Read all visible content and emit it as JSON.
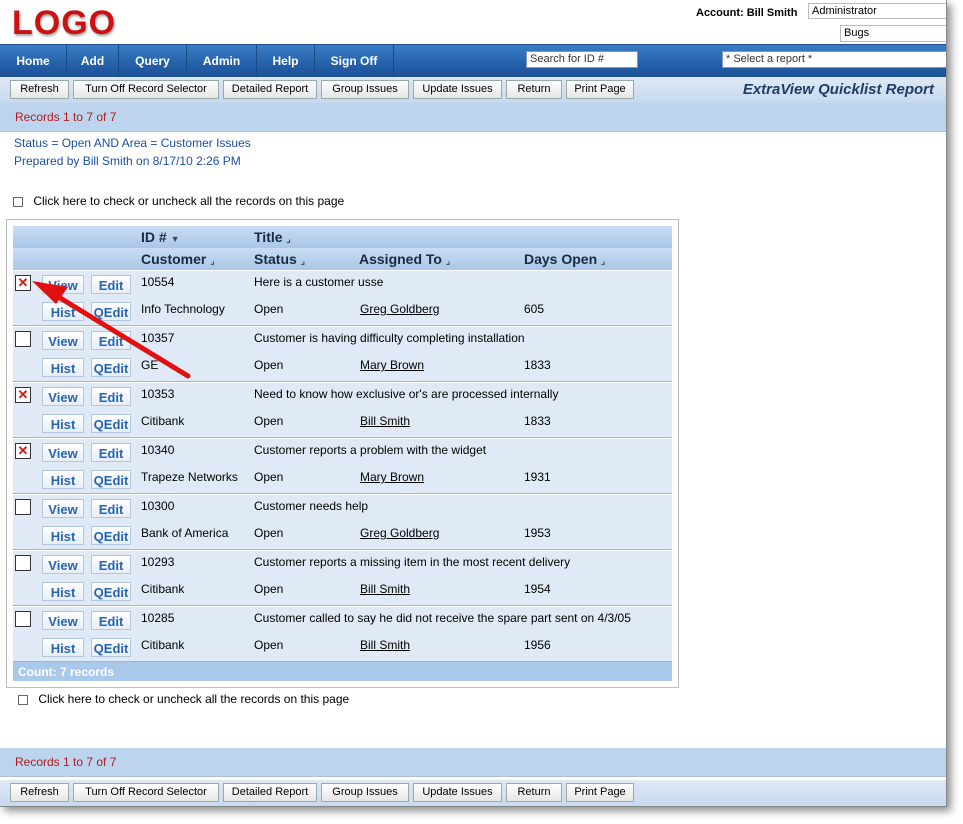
{
  "header": {
    "logo": "LOGO",
    "account_label": "Account: Bill Smith",
    "role_value": "Administrator",
    "project_value": "Bugs"
  },
  "nav": {
    "items": [
      "Home",
      "Add",
      "Query",
      "Admin",
      "Help",
      "Sign Off"
    ],
    "search_placeholder": "Search for ID #",
    "report_select_value": "* Select a report *"
  },
  "toolbar": {
    "buttons": [
      "Refresh",
      "Turn Off Record Selector",
      "Detailed Report",
      "Group Issues",
      "Update Issues",
      "Return",
      "Print Page"
    ],
    "report_title": "ExtraView Quicklist Report"
  },
  "records_text": "Records 1 to 7 of 7",
  "filter": {
    "criteria": "Status = Open AND Area = Customer Issues",
    "prepared": "Prepared by Bill Smith on 8/17/10 2:26 PM"
  },
  "check_all_label": "Click here to check or uncheck all the records on this page",
  "table": {
    "headers": {
      "id": "ID #",
      "title": "Title",
      "customer": "Customer",
      "status": "Status",
      "assigned_to": "Assigned To",
      "days_open": "Days Open"
    },
    "buttons": {
      "view": "View",
      "edit": "Edit",
      "hist": "Hist",
      "qedit": "QEdit"
    },
    "rows": [
      {
        "checked": true,
        "id": "10554",
        "title": "Here is a customer usse",
        "customer": "Info Technology",
        "status": "Open",
        "assigned_to": "Greg Goldberg",
        "days_open": "605"
      },
      {
        "checked": false,
        "id": "10357",
        "title": "Customer is having difficulty completing installation",
        "customer": "GE",
        "status": "Open",
        "assigned_to": "Mary Brown",
        "days_open": "1833"
      },
      {
        "checked": true,
        "id": "10353",
        "title": "Need to know how exclusive or's are processed internally",
        "customer": "Citibank",
        "status": "Open",
        "assigned_to": "Bill Smith",
        "days_open": "1833"
      },
      {
        "checked": true,
        "id": "10340",
        "title": "Customer reports a problem with the widget",
        "customer": "Trapeze Networks",
        "status": "Open",
        "assigned_to": "Mary Brown",
        "days_open": "1931"
      },
      {
        "checked": false,
        "id": "10300",
        "title": "Customer needs help",
        "customer": "Bank of America",
        "status": "Open",
        "assigned_to": "Greg Goldberg",
        "days_open": "1953"
      },
      {
        "checked": false,
        "id": "10293",
        "title": "Customer reports a missing item in the most recent delivery",
        "customer": "Citibank",
        "status": "Open",
        "assigned_to": "Bill Smith",
        "days_open": "1954"
      },
      {
        "checked": false,
        "id": "10285",
        "title": "Customer called to say he did not receive the spare part sent on 4/3/05",
        "customer": "Citibank",
        "status": "Open",
        "assigned_to": "Bill Smith",
        "days_open": "1956"
      }
    ],
    "count_text": "Count: 7 records"
  },
  "colors": {
    "nav_blue": "#2460a8",
    "records_red": "#b01c1c",
    "filter_blue": "#1d4fa3",
    "row_bg": "#dfeaf6",
    "annotation_arrow": "#e01010"
  }
}
